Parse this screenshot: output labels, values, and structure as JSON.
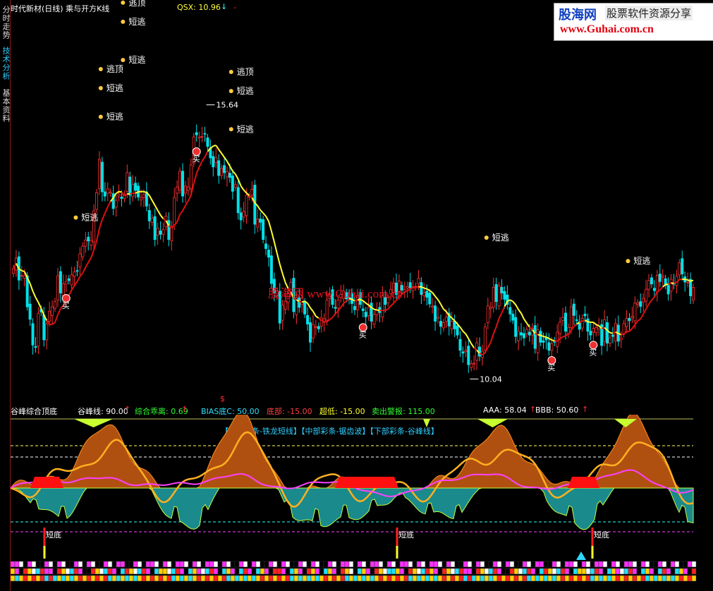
{
  "sidebar": {
    "tabs": [
      "分时走势",
      "技术分析",
      "基本资料"
    ]
  },
  "top_panel": {
    "title": "时代新材(日线) 乘与开方K线",
    "qsx_label": "QSX: 10.96",
    "qsx_arrow": "↓",
    "dash_marker": "-",
    "high_label": "15.64",
    "low_label": "10.04",
    "colors": {
      "up": "#ff3030",
      "down": "#00e0e8",
      "qsx_up": "#e01010",
      "qsx_down": "#ffff30"
    }
  },
  "signals": {
    "escape_top": "逃顶",
    "short_escape": "短逃",
    "buy": "买"
  },
  "logo": {
    "name": "股海网",
    "slogan": "股票软件资源分享",
    "url": "www.Guhai.com.cn"
  },
  "watermark": {
    "text": "股海网  www.Guhai.com.cn"
  },
  "dollar_marker": "$",
  "bottom_panel": {
    "title": "谷峰综合顶底",
    "indicators": [
      {
        "label": "谷峰线: 90.00",
        "arrow": "↑",
        "color": "#ffffff"
      },
      {
        "label": "综合乖离: 0.69",
        "arrow": "↑",
        "color": "#30ff30"
      },
      {
        "label": "BIAS底C: 50.00",
        "arrow": "",
        "color": "#30e0ff"
      },
      {
        "label": "底部: -15.00",
        "arrow": "",
        "color": "#ff4040"
      },
      {
        "label": "超低: -15.00",
        "arrow": "",
        "color": "#ffff30"
      },
      {
        "label": "卖出警报: 115.00",
        "arrow": "",
        "color": "#30ff30"
      },
      {
        "label": "AAA: 58.04",
        "arrow": "↑",
        "color": "#ffffff"
      },
      {
        "label": "BBB: 50.60",
        "arrow": "↑",
        "color": "#ffffff"
      }
    ],
    "legend": "【上部彩条-铁龙短线】【中部彩条-锯齿波】【下部彩条-谷峰线】",
    "bottom_label": "短底"
  },
  "chart_data": {
    "type": "candlestick",
    "title": "时代新材(日线) 乘与开方K线",
    "ylim": [
      9.3,
      17.2
    ],
    "x": [
      1,
      2,
      3,
      4,
      5,
      6,
      7,
      8,
      9,
      10,
      11,
      12,
      13,
      14,
      15,
      16,
      17,
      18,
      19,
      20,
      21,
      22,
      23,
      24,
      25,
      26,
      27,
      28,
      29,
      30,
      31,
      32,
      33,
      34,
      35,
      36,
      37,
      38,
      39,
      40,
      41,
      42,
      43,
      44,
      45,
      46,
      47,
      48,
      49,
      50,
      51,
      52,
      53,
      54,
      55,
      56,
      57,
      58,
      59,
      60,
      61,
      62,
      63,
      64,
      65,
      66,
      67,
      68,
      69,
      70,
      71,
      72,
      73,
      74,
      75,
      76,
      77,
      78,
      79,
      80,
      81,
      82,
      83,
      84,
      85,
      86,
      87,
      88,
      89,
      90,
      91,
      92,
      93,
      94,
      95,
      96,
      97,
      98,
      99,
      100,
      101,
      102,
      103,
      104,
      105,
      106,
      107,
      108,
      109,
      110,
      111,
      112,
      113,
      114,
      115,
      116,
      117,
      118,
      119,
      120,
      121,
      122,
      123,
      124,
      125,
      126,
      127,
      128,
      129,
      130,
      131,
      132,
      133,
      134,
      135,
      136,
      137,
      138,
      139,
      140,
      141,
      142,
      143,
      144,
      145,
      146,
      147,
      148,
      149,
      150,
      151,
      152,
      153,
      154,
      155,
      156,
      157,
      158,
      159,
      160,
      161,
      162,
      163,
      164,
      165,
      166,
      167,
      168,
      169,
      170,
      171,
      172,
      173,
      174,
      175,
      176,
      177,
      178,
      179,
      180,
      181,
      182,
      183,
      184,
      185,
      186,
      187,
      188,
      189,
      190,
      191,
      192,
      193,
      194,
      195,
      196,
      197,
      198,
      199,
      200,
      201,
      202,
      203,
      204,
      205,
      206,
      207,
      208,
      209,
      210,
      211,
      212,
      213,
      214,
      215,
      216,
      217,
      218,
      219,
      220,
      221,
      222,
      223,
      224,
      225,
      226,
      227,
      228,
      229,
      230,
      231,
      232,
      233,
      234,
      235,
      236,
      237,
      238,
      239,
      240
    ],
    "close": [
      11.87,
      12.09,
      11.63,
      11.73,
      11.72,
      11.07,
      10.81,
      10.27,
      10.22,
      10.93,
      10.96,
      10.38,
      10.71,
      10.98,
      11.07,
      11.18,
      11.72,
      11.36,
      11.55,
      11.6,
      11.62,
      11.74,
      11.8,
      11.82,
      12.18,
      12.34,
      12.47,
      12.45,
      12.46,
      13.08,
      13.46,
      14.16,
      13.48,
      13.39,
      13.54,
      13.47,
      13.13,
      13.3,
      13.43,
      13.34,
      13.43,
      13.88,
      13.41,
      13.63,
      13.51,
      13.37,
      13.36,
      13.42,
      13.18,
      12.87,
      12.93,
      12.48,
      12.72,
      12.59,
      12.69,
      12.97,
      12.48,
      12.76,
      13.36,
      13.58,
      13.91,
      13.39,
      13.6,
      13.58,
      14.04,
      14.63,
      14.67,
      14.63,
      14.64,
      14.7,
      14.43,
      14.19,
      14.0,
      14.19,
      13.82,
      13.97,
      13.88,
      13.9,
      13.78,
      13.49,
      13.63,
      13.04,
      12.89,
      13.07,
      13.41,
      13.38,
      13.53,
      12.8,
      12.91,
      12.84,
      12.48,
      12.29,
      12.11,
      11.56,
      11.36,
      11.4,
      10.73,
      11.11,
      11.19,
      11.36,
      11.58,
      10.97,
      11.26,
      11.06,
      11.26,
      10.92,
      10.71,
      10.33,
      10.7,
      10.66,
      10.61,
      10.84,
      10.82,
      11.21,
      11.34,
      11.12,
      11.04,
      11.21,
      11.33,
      11.4,
      11.24,
      11.26,
      11.14,
      11.01,
      11.31,
      11.12,
      10.99,
      10.86,
      11.06,
      10.77,
      10.91,
      11.0,
      10.95,
      11.3,
      11.12,
      11.26,
      11.43,
      11.57,
      11.33,
      11.61,
      11.42,
      11.43,
      11.49,
      11.47,
      11.49,
      11.5,
      11.67,
      11.33,
      11.37,
      11.27,
      11.13,
      11.09,
      10.77,
      10.86,
      10.66,
      10.74,
      10.85,
      10.67,
      10.77,
      10.61,
      10.48,
      10.16,
      10.1,
      10.16,
      9.86,
      9.88,
      9.89,
      10.32,
      10.04,
      10.14,
      10.65,
      11.09,
      11.06,
      11.48,
      11.18,
      11.51,
      11.36,
      11.23,
      11.12,
      10.92,
      10.79,
      10.45,
      10.56,
      10.48,
      10.42,
      10.6,
      10.48,
      10.62,
      10.2,
      10.59,
      10.33,
      10.33,
      10.38,
      10.16,
      10.3,
      10.33,
      10.54,
      10.75,
      10.85,
      10.56,
      10.64,
      11.07,
      10.89,
      10.79,
      10.6,
      10.83,
      10.88,
      10.56,
      10.48,
      10.62,
      10.64,
      10.67,
      10.26,
      10.8,
      10.31,
      10.42,
      10.45,
      10.72,
      10.35,
      10.42,
      10.72,
      10.83,
      10.78,
      10.87,
      11.15,
      11.15,
      11.08,
      11.25,
      11.44,
      11.62,
      11.55,
      11.41,
      11.73,
      11.6,
      11.72,
      11.52,
      11.34,
      11.65,
      11.55,
      11.71,
      11.99,
      11.76,
      11.59,
      11.59,
      11.3,
      11.48
    ]
  }
}
